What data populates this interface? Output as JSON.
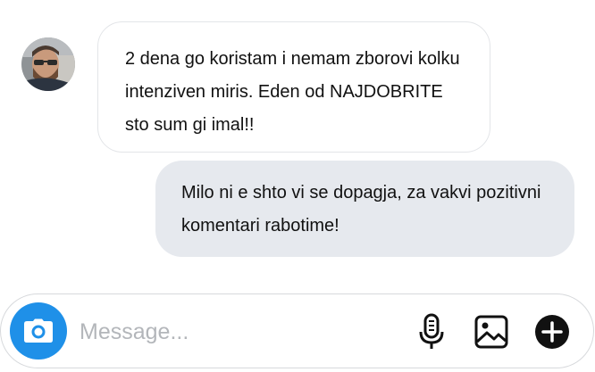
{
  "conversation": {
    "messages": [
      {
        "direction": "incoming",
        "sender_avatar": "user-avatar",
        "text": "2 dena go koristam i nemam zborovi kolku intenziven miris. Eden od NAJDOBRITE sto sum gi imal!!"
      },
      {
        "direction": "outgoing",
        "text": "Milo ni e shto vi se dopagja, za vakvi pozitivni komentari rabotime!"
      }
    ]
  },
  "composer": {
    "placeholder": "Message...",
    "value": "",
    "icons": {
      "camera": "camera-icon",
      "mic": "microphone-icon",
      "gallery": "image-icon",
      "add": "plus-circle-icon"
    },
    "camera_color": "#1f90e8"
  },
  "colors": {
    "incoming_bubble_border": "#e3e5e8",
    "outgoing_bubble_bg": "#e6e9ee"
  }
}
